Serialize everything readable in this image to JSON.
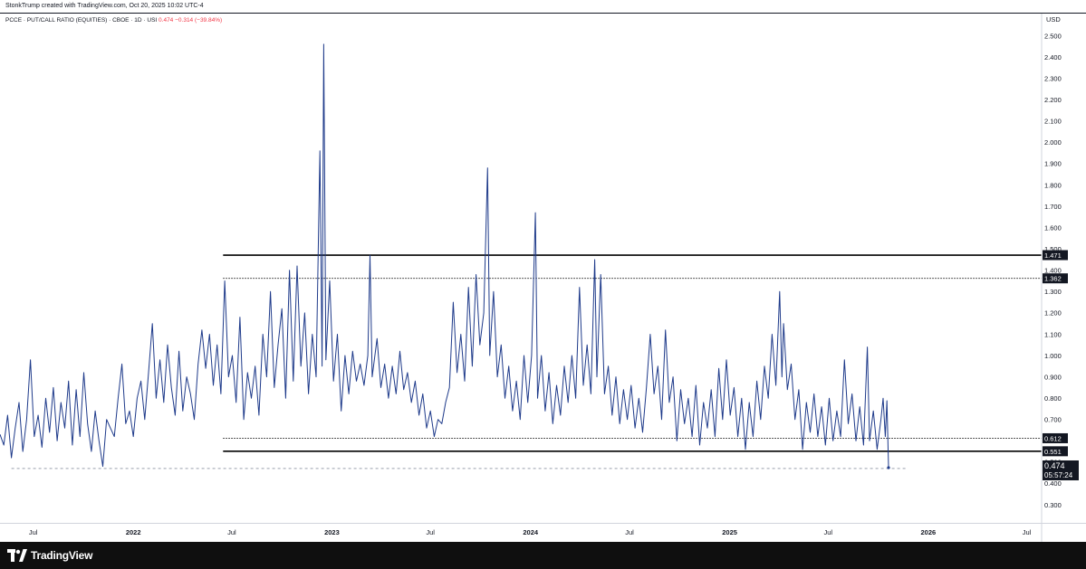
{
  "header": {
    "credit": "StonkTrump created with TradingView.com, Oct 20, 2025 10:02 UTC-4"
  },
  "legend": {
    "symbol": "PCCE · PUT/CALL RATIO (EQUITIES) · CBOE · 1D · USI",
    "last": "0.474",
    "change": "−0.314 (−39.84%)",
    "change_color": "#f23645"
  },
  "footer": {
    "brand": "TradingView"
  },
  "colors": {
    "series": "#1e3a8a",
    "price_label_bg": "#131722",
    "grid_text": "#131722"
  },
  "chart_data": {
    "type": "line",
    "currency": "USD",
    "y_ticks": [
      "2.500",
      "2.400",
      "2.300",
      "2.200",
      "2.100",
      "2.000",
      "1.900",
      "1.800",
      "1.700",
      "1.600",
      "1.500",
      "1.400",
      "1.300",
      "1.200",
      "1.100",
      "1.000",
      "0.900",
      "0.800",
      "0.700",
      "0.600",
      "0.500",
      "0.400",
      "0.300"
    ],
    "y_tick_values": [
      2.5,
      2.4,
      2.3,
      2.2,
      2.1,
      2.0,
      1.9,
      1.8,
      1.7,
      1.6,
      1.5,
      1.4,
      1.3,
      1.2,
      1.1,
      1.0,
      0.9,
      0.8,
      0.7,
      0.6,
      0.5,
      0.4,
      0.3
    ],
    "ylim": [
      0.2,
      2.58
    ],
    "x_range": [
      "2021-05-01",
      "2026-07-25"
    ],
    "x_ticks": [
      {
        "label": "Jul",
        "date": "2021-07-01",
        "bold": false
      },
      {
        "label": "2022",
        "date": "2022-01-01",
        "bold": true
      },
      {
        "label": "Jul",
        "date": "2022-07-01",
        "bold": false
      },
      {
        "label": "2023",
        "date": "2023-01-01",
        "bold": true
      },
      {
        "label": "Jul",
        "date": "2023-07-01",
        "bold": false
      },
      {
        "label": "2024",
        "date": "2024-01-01",
        "bold": true
      },
      {
        "label": "Jul",
        "date": "2024-07-01",
        "bold": false
      },
      {
        "label": "2025",
        "date": "2025-01-01",
        "bold": true
      },
      {
        "label": "Jul",
        "date": "2025-07-01",
        "bold": false
      },
      {
        "label": "2026",
        "date": "2026-01-01",
        "bold": true
      },
      {
        "label": "Jul",
        "date": "2026-07-01",
        "bold": false
      }
    ],
    "horizontal_lines": [
      {
        "value": 1.471,
        "label": "1.471",
        "style": "solid",
        "from": "2022-06-15"
      },
      {
        "value": 1.362,
        "label": "1.362",
        "style": "dotted",
        "from": "2022-06-15"
      },
      {
        "value": 0.612,
        "label": "0.612",
        "style": "dotted",
        "from": "2022-06-15"
      },
      {
        "value": 0.551,
        "label": "0.551",
        "style": "solid",
        "from": "2022-06-15"
      },
      {
        "value": 0.47,
        "label": "",
        "style": "dashed-gray",
        "from": "2021-05-22",
        "to": "2025-11-20"
      }
    ],
    "last_price": {
      "value": 0.474,
      "label": "0.474",
      "countdown": "05:57:24"
    },
    "series": [
      {
        "values": [
          [
            "2021-05-01",
            0.63
          ],
          [
            "2021-05-08",
            0.58
          ],
          [
            "2021-05-15",
            0.72
          ],
          [
            "2021-05-22",
            0.52
          ],
          [
            "2021-05-29",
            0.66
          ],
          [
            "2021-06-05",
            0.78
          ],
          [
            "2021-06-12",
            0.55
          ],
          [
            "2021-06-19",
            0.7
          ],
          [
            "2021-06-26",
            0.98
          ],
          [
            "2021-07-03",
            0.62
          ],
          [
            "2021-07-10",
            0.72
          ],
          [
            "2021-07-17",
            0.57
          ],
          [
            "2021-07-24",
            0.8
          ],
          [
            "2021-07-31",
            0.64
          ],
          [
            "2021-08-07",
            0.85
          ],
          [
            "2021-08-14",
            0.6
          ],
          [
            "2021-08-21",
            0.78
          ],
          [
            "2021-08-28",
            0.66
          ],
          [
            "2021-09-04",
            0.88
          ],
          [
            "2021-09-11",
            0.58
          ],
          [
            "2021-09-18",
            0.84
          ],
          [
            "2021-09-25",
            0.62
          ],
          [
            "2021-10-02",
            0.92
          ],
          [
            "2021-10-09",
            0.68
          ],
          [
            "2021-10-16",
            0.55
          ],
          [
            "2021-10-23",
            0.74
          ],
          [
            "2021-10-30",
            0.6
          ],
          [
            "2021-11-06",
            0.48
          ],
          [
            "2021-11-13",
            0.7
          ],
          [
            "2021-11-20",
            0.66
          ],
          [
            "2021-11-27",
            0.62
          ],
          [
            "2021-12-04",
            0.8
          ],
          [
            "2021-12-11",
            0.96
          ],
          [
            "2021-12-18",
            0.68
          ],
          [
            "2021-12-25",
            0.74
          ],
          [
            "2022-01-01",
            0.62
          ],
          [
            "2022-01-08",
            0.8
          ],
          [
            "2022-01-15",
            0.88
          ],
          [
            "2022-01-22",
            0.7
          ],
          [
            "2022-01-29",
            0.92
          ],
          [
            "2022-02-05",
            1.15
          ],
          [
            "2022-02-12",
            0.8
          ],
          [
            "2022-02-19",
            0.98
          ],
          [
            "2022-02-26",
            0.78
          ],
          [
            "2022-03-05",
            1.05
          ],
          [
            "2022-03-12",
            0.85
          ],
          [
            "2022-03-19",
            0.72
          ],
          [
            "2022-03-26",
            1.02
          ],
          [
            "2022-04-02",
            0.74
          ],
          [
            "2022-04-09",
            0.9
          ],
          [
            "2022-04-16",
            0.82
          ],
          [
            "2022-04-23",
            0.7
          ],
          [
            "2022-04-30",
            0.96
          ],
          [
            "2022-05-07",
            1.12
          ],
          [
            "2022-05-14",
            0.94
          ],
          [
            "2022-05-21",
            1.1
          ],
          [
            "2022-05-28",
            0.86
          ],
          [
            "2022-06-04",
            1.05
          ],
          [
            "2022-06-11",
            0.82
          ],
          [
            "2022-06-18",
            1.35
          ],
          [
            "2022-06-25",
            0.9
          ],
          [
            "2022-07-02",
            1.0
          ],
          [
            "2022-07-09",
            0.78
          ],
          [
            "2022-07-16",
            1.18
          ],
          [
            "2022-07-23",
            0.7
          ],
          [
            "2022-07-30",
            0.92
          ],
          [
            "2022-08-06",
            0.8
          ],
          [
            "2022-08-13",
            0.95
          ],
          [
            "2022-08-20",
            0.72
          ],
          [
            "2022-08-27",
            1.1
          ],
          [
            "2022-09-03",
            0.9
          ],
          [
            "2022-09-10",
            1.3
          ],
          [
            "2022-09-17",
            0.85
          ],
          [
            "2022-09-24",
            1.05
          ],
          [
            "2022-10-01",
            1.22
          ],
          [
            "2022-10-08",
            0.8
          ],
          [
            "2022-10-15",
            1.4
          ],
          [
            "2022-10-22",
            0.88
          ],
          [
            "2022-10-29",
            1.42
          ],
          [
            "2022-11-05",
            0.95
          ],
          [
            "2022-11-12",
            1.2
          ],
          [
            "2022-11-19",
            0.82
          ],
          [
            "2022-11-26",
            1.1
          ],
          [
            "2022-12-03",
            0.9
          ],
          [
            "2022-12-10",
            1.96
          ],
          [
            "2022-12-14",
            0.95
          ],
          [
            "2022-12-17",
            2.46
          ],
          [
            "2022-12-21",
            0.98
          ],
          [
            "2022-12-28",
            1.35
          ],
          [
            "2023-01-04",
            0.88
          ],
          [
            "2023-01-11",
            1.1
          ],
          [
            "2023-01-18",
            0.74
          ],
          [
            "2023-01-25",
            1.0
          ],
          [
            "2023-02-01",
            0.82
          ],
          [
            "2023-02-08",
            1.02
          ],
          [
            "2023-02-15",
            0.88
          ],
          [
            "2023-02-22",
            0.96
          ],
          [
            "2023-03-01",
            0.86
          ],
          [
            "2023-03-08",
            1.0
          ],
          [
            "2023-03-12",
            1.47
          ],
          [
            "2023-03-16",
            0.9
          ],
          [
            "2023-03-25",
            1.08
          ],
          [
            "2023-04-01",
            0.85
          ],
          [
            "2023-04-08",
            0.96
          ],
          [
            "2023-04-15",
            0.8
          ],
          [
            "2023-04-22",
            0.95
          ],
          [
            "2023-04-29",
            0.82
          ],
          [
            "2023-05-06",
            1.02
          ],
          [
            "2023-05-13",
            0.84
          ],
          [
            "2023-05-20",
            0.92
          ],
          [
            "2023-05-27",
            0.78
          ],
          [
            "2023-06-03",
            0.88
          ],
          [
            "2023-06-10",
            0.72
          ],
          [
            "2023-06-17",
            0.82
          ],
          [
            "2023-06-24",
            0.66
          ],
          [
            "2023-07-01",
            0.74
          ],
          [
            "2023-07-08",
            0.62
          ],
          [
            "2023-07-15",
            0.7
          ],
          [
            "2023-07-22",
            0.68
          ],
          [
            "2023-07-29",
            0.78
          ],
          [
            "2023-08-05",
            0.85
          ],
          [
            "2023-08-12",
            1.25
          ],
          [
            "2023-08-19",
            0.92
          ],
          [
            "2023-08-26",
            1.1
          ],
          [
            "2023-09-02",
            0.88
          ],
          [
            "2023-09-09",
            1.32
          ],
          [
            "2023-09-16",
            0.95
          ],
          [
            "2023-09-23",
            1.38
          ],
          [
            "2023-09-30",
            1.05
          ],
          [
            "2023-10-07",
            1.2
          ],
          [
            "2023-10-14",
            1.88
          ],
          [
            "2023-10-18",
            1.0
          ],
          [
            "2023-10-25",
            1.3
          ],
          [
            "2023-11-01",
            0.9
          ],
          [
            "2023-11-08",
            1.05
          ],
          [
            "2023-11-15",
            0.8
          ],
          [
            "2023-11-22",
            0.95
          ],
          [
            "2023-11-29",
            0.74
          ],
          [
            "2023-12-06",
            0.88
          ],
          [
            "2023-12-13",
            0.7
          ],
          [
            "2023-12-20",
            1.0
          ],
          [
            "2023-12-27",
            0.78
          ],
          [
            "2024-01-03",
            1.0
          ],
          [
            "2024-01-10",
            1.67
          ],
          [
            "2024-01-14",
            0.8
          ],
          [
            "2024-01-21",
            1.0
          ],
          [
            "2024-01-28",
            0.74
          ],
          [
            "2024-02-04",
            0.92
          ],
          [
            "2024-02-11",
            0.68
          ],
          [
            "2024-02-18",
            0.86
          ],
          [
            "2024-02-25",
            0.72
          ],
          [
            "2024-03-03",
            0.95
          ],
          [
            "2024-03-10",
            0.78
          ],
          [
            "2024-03-17",
            1.0
          ],
          [
            "2024-03-24",
            0.8
          ],
          [
            "2024-03-31",
            1.32
          ],
          [
            "2024-04-07",
            0.86
          ],
          [
            "2024-04-14",
            1.05
          ],
          [
            "2024-04-21",
            0.82
          ],
          [
            "2024-04-28",
            1.45
          ],
          [
            "2024-05-02",
            0.9
          ],
          [
            "2024-05-09",
            1.38
          ],
          [
            "2024-05-16",
            0.82
          ],
          [
            "2024-05-23",
            0.95
          ],
          [
            "2024-05-30",
            0.72
          ],
          [
            "2024-06-06",
            0.9
          ],
          [
            "2024-06-13",
            0.68
          ],
          [
            "2024-06-20",
            0.84
          ],
          [
            "2024-06-27",
            0.7
          ],
          [
            "2024-07-04",
            0.86
          ],
          [
            "2024-07-11",
            0.66
          ],
          [
            "2024-07-18",
            0.8
          ],
          [
            "2024-07-25",
            0.64
          ],
          [
            "2024-08-01",
            0.85
          ],
          [
            "2024-08-08",
            1.1
          ],
          [
            "2024-08-15",
            0.82
          ],
          [
            "2024-08-22",
            0.95
          ],
          [
            "2024-08-29",
            0.7
          ],
          [
            "2024-09-05",
            1.12
          ],
          [
            "2024-09-12",
            0.78
          ],
          [
            "2024-09-19",
            0.9
          ],
          [
            "2024-09-26",
            0.6
          ],
          [
            "2024-10-03",
            0.84
          ],
          [
            "2024-10-10",
            0.68
          ],
          [
            "2024-10-17",
            0.8
          ],
          [
            "2024-10-24",
            0.62
          ],
          [
            "2024-10-31",
            0.86
          ],
          [
            "2024-11-07",
            0.58
          ],
          [
            "2024-11-14",
            0.78
          ],
          [
            "2024-11-21",
            0.66
          ],
          [
            "2024-11-28",
            0.84
          ],
          [
            "2024-12-05",
            0.62
          ],
          [
            "2024-12-12",
            0.94
          ],
          [
            "2024-12-19",
            0.7
          ],
          [
            "2024-12-26",
            0.98
          ],
          [
            "2025-01-02",
            0.72
          ],
          [
            "2025-01-09",
            0.85
          ],
          [
            "2025-01-16",
            0.62
          ],
          [
            "2025-01-23",
            0.8
          ],
          [
            "2025-01-30",
            0.56
          ],
          [
            "2025-02-06",
            0.78
          ],
          [
            "2025-02-13",
            0.62
          ],
          [
            "2025-02-20",
            0.88
          ],
          [
            "2025-02-27",
            0.7
          ],
          [
            "2025-03-06",
            0.95
          ],
          [
            "2025-03-13",
            0.8
          ],
          [
            "2025-03-20",
            1.1
          ],
          [
            "2025-03-27",
            0.86
          ],
          [
            "2025-04-03",
            1.3
          ],
          [
            "2025-04-07",
            0.9
          ],
          [
            "2025-04-10",
            1.15
          ],
          [
            "2025-04-17",
            0.84
          ],
          [
            "2025-04-24",
            0.96
          ],
          [
            "2025-05-01",
            0.7
          ],
          [
            "2025-05-08",
            0.84
          ],
          [
            "2025-05-15",
            0.56
          ],
          [
            "2025-05-22",
            0.78
          ],
          [
            "2025-05-29",
            0.64
          ],
          [
            "2025-06-05",
            0.82
          ],
          [
            "2025-06-12",
            0.62
          ],
          [
            "2025-06-19",
            0.76
          ],
          [
            "2025-06-26",
            0.58
          ],
          [
            "2025-07-03",
            0.8
          ],
          [
            "2025-07-10",
            0.6
          ],
          [
            "2025-07-17",
            0.74
          ],
          [
            "2025-07-24",
            0.62
          ],
          [
            "2025-07-31",
            0.98
          ],
          [
            "2025-08-07",
            0.68
          ],
          [
            "2025-08-14",
            0.82
          ],
          [
            "2025-08-21",
            0.6
          ],
          [
            "2025-08-28",
            0.76
          ],
          [
            "2025-09-04",
            0.58
          ],
          [
            "2025-09-11",
            1.04
          ],
          [
            "2025-09-15",
            0.6
          ],
          [
            "2025-09-22",
            0.74
          ],
          [
            "2025-09-29",
            0.56
          ],
          [
            "2025-10-06",
            0.7
          ],
          [
            "2025-10-10",
            0.8
          ],
          [
            "2025-10-14",
            0.62
          ],
          [
            "2025-10-17",
            0.788
          ],
          [
            "2025-10-20",
            0.474
          ]
        ]
      }
    ]
  }
}
